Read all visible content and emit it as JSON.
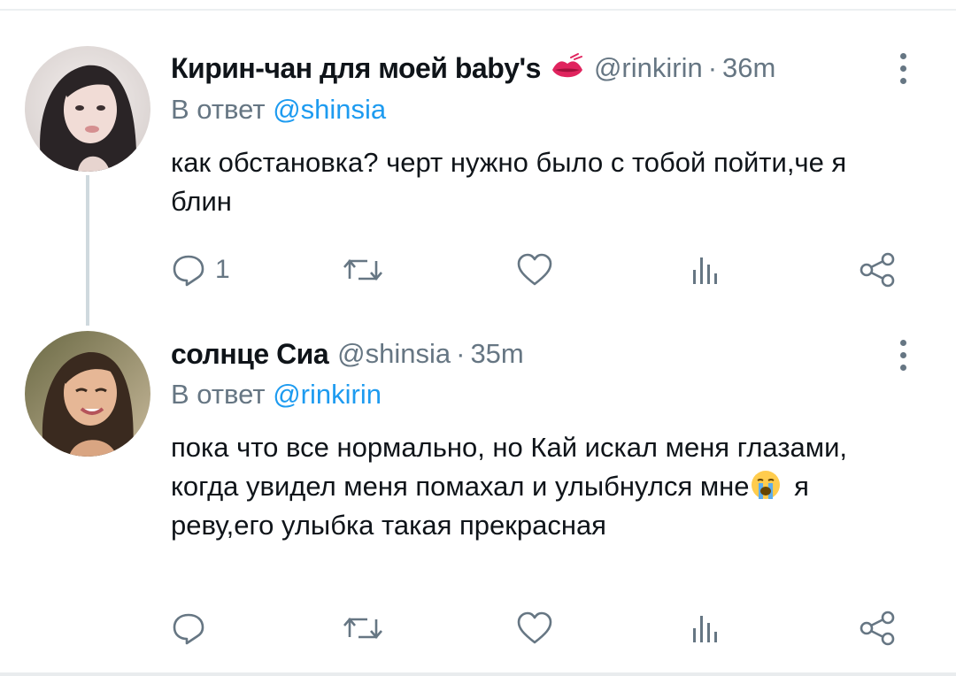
{
  "tweets": [
    {
      "name": "Кирин-чан для моей baby's",
      "name_emoji": "kiss-mark-emoji",
      "handle": "@rinkirin",
      "time": "36m",
      "reply_prefix": "В ответ",
      "reply_mention": "@shinsia",
      "text": "как обстановка? черт нужно было с тобой пойти,че я блин",
      "reply_count": "1"
    },
    {
      "name": "солнце Сиа",
      "handle": "@shinsia",
      "time": "35m",
      "reply_prefix": "В ответ",
      "reply_mention": "@rinkirin",
      "text_before_emoji": "пока что все нормально, но Кай искал меня глазами, когда увидел меня помахал и улыбнулся мне",
      "inline_emoji": "loudly-crying-face-emoji",
      "text_after_emoji": " я реву,его улыбка такая прекрасная",
      "reply_count": ""
    }
  ],
  "separator": "·",
  "icons": {
    "reply": "reply-icon",
    "retweet": "retweet-icon",
    "like": "heart-icon",
    "analytics": "analytics-icon",
    "share": "share-icon",
    "menu": "more-vertical-icon"
  },
  "colors": {
    "text": "#0f1419",
    "secondary": "#667683",
    "link": "#1d9bf0",
    "thread_line": "#cfd9de"
  }
}
